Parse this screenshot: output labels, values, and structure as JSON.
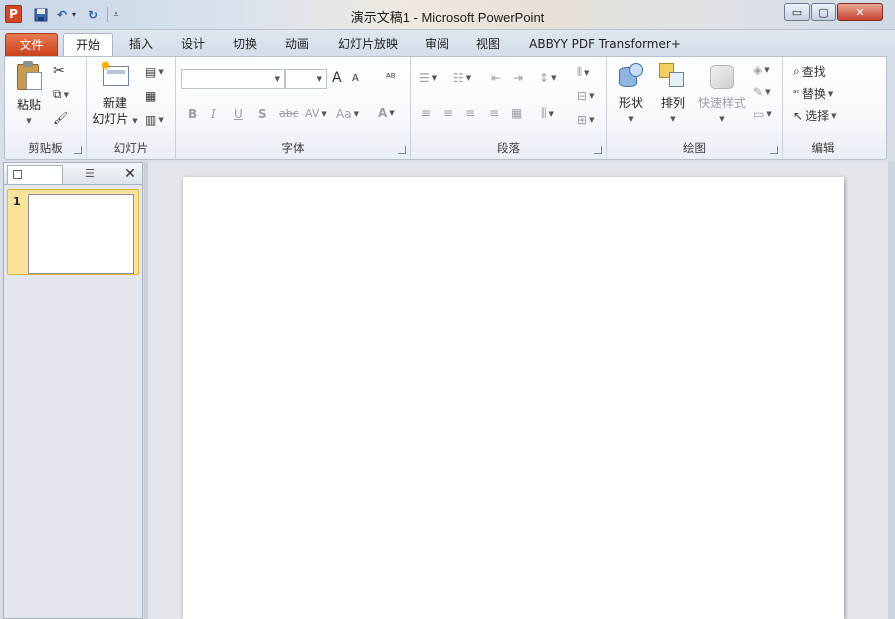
{
  "window": {
    "app_icon": "P",
    "title": "演示文稿1 - Microsoft PowerPoint",
    "min_icon": "minimize-icon",
    "max_icon": "maximize-icon",
    "close_icon": "close-icon",
    "min_glyph": "▭",
    "max_glyph": "▢",
    "close_glyph": "✕"
  },
  "quick_access": {
    "undo_glyph": "↶",
    "redo_glyph": "↻",
    "dropdown_glyph": "▾",
    "customize_glyph": "⩡"
  },
  "tabs": [
    {
      "label": "文件"
    },
    {
      "label": "开始"
    },
    {
      "label": "插入"
    },
    {
      "label": "设计"
    },
    {
      "label": "切换"
    },
    {
      "label": "动画"
    },
    {
      "label": "幻灯片放映"
    },
    {
      "label": "审阅"
    },
    {
      "label": "视图"
    },
    {
      "label": "ABBYY PDF Transformer+"
    }
  ],
  "ribbon_controls": {
    "minimize_glyph": "˄",
    "help_glyph": "?"
  },
  "ribbon": {
    "clipboard": {
      "label": "剪贴板",
      "paste": "粘贴",
      "cut_glyph": "✂",
      "copy_glyph": "⧉",
      "format_painter_glyph": "🖌"
    },
    "slides": {
      "label": "幻灯片",
      "new_slide_line1": "新建",
      "new_slide_line2": "幻灯片",
      "layout_glyph": "▤",
      "reset_glyph": "▦",
      "section_glyph": "▥"
    },
    "font": {
      "label": "字体",
      "grow": "A",
      "shrink": "A",
      "clear_format": "ᴬᴮ",
      "bold": "B",
      "italic": "I",
      "underline": "U",
      "shadow": "S",
      "strikethrough": "abc",
      "spacing": "AV",
      "case": "Aa",
      "color": "A"
    },
    "paragraph": {
      "label": "段落",
      "bullets": "☰",
      "numbering": "☷",
      "decrease_indent": "⇤",
      "increase_indent": "⇥",
      "line_spacing": "↕",
      "text_direction": "⫴",
      "align_text": "⊟",
      "smartart": "⊞",
      "align_left": "≡",
      "center": "≡",
      "align_right": "≡",
      "justify": "≡",
      "distributed": "▦",
      "columns": "⫼"
    },
    "drawing": {
      "label": "绘图",
      "shapes": "形状",
      "arrange": "排列",
      "quick_styles": "快速样式",
      "fill_glyph": "◈",
      "outline_glyph": "✎",
      "effects_glyph": "▭"
    },
    "editing": {
      "label": "编辑",
      "find": "查找",
      "replace": "替换",
      "select": "选择",
      "find_glyph": "⌕",
      "replace_glyph": "ᵃᶜ",
      "select_glyph": "↖"
    }
  },
  "slide_panel": {
    "outline_glyph": "☰",
    "close_glyph": "✕",
    "thumbnails": [
      {
        "number": "1"
      }
    ]
  }
}
